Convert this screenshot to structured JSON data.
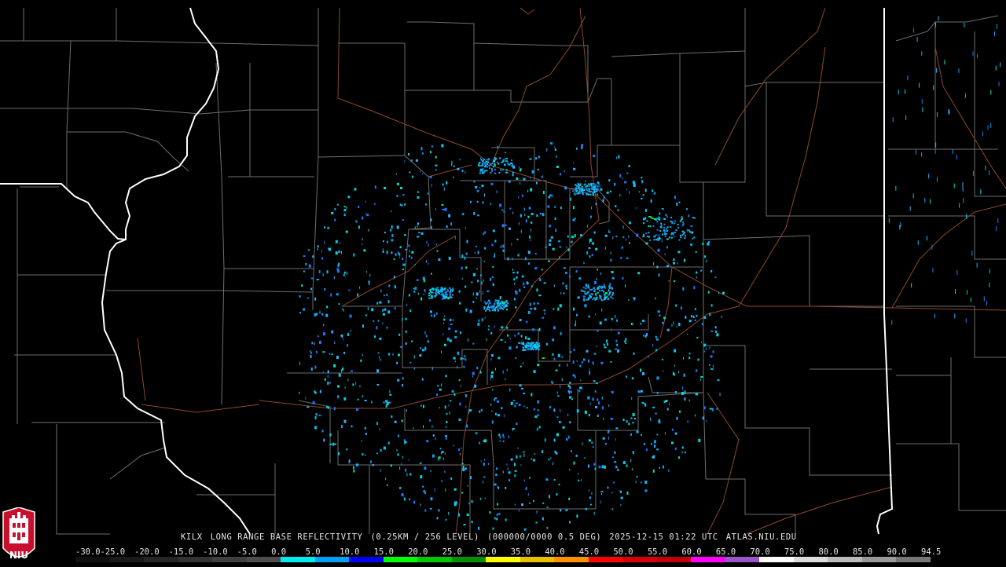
{
  "radar": {
    "station": "KILX",
    "product": "LONG RANGE BASE REFLECTIVITY",
    "resolution": "(0.25KM / 256 LEVEL)",
    "elevation": "(000000/0000 0.5 DEG)",
    "timestamp": "2025-12-15 01:22 UTC",
    "source": "ATLAS.NIU.EDU"
  },
  "scale": {
    "labels": [
      "-30.0",
      "-25.0",
      "-20.0",
      "-15.0",
      "-10.0",
      "-5.0",
      "0.0",
      "5.0",
      "10.0",
      "15.0",
      "20.0",
      "25.0",
      "30.0",
      "35.0",
      "40.0",
      "45.0",
      "50.0",
      "55.0",
      "60.0",
      "65.0",
      "70.0",
      "75.0",
      "80.0",
      "85.0",
      "90.0",
      "94.5"
    ],
    "colors": [
      "#101010",
      "#1a1a1a",
      "#262626",
      "#333333",
      "#404040",
      "#4d4d4d",
      "#00ecec",
      "#01a0f6",
      "#0000f6",
      "#00ff00",
      "#00c800",
      "#009000",
      "#ffff00",
      "#e7c000",
      "#ff9000",
      "#ff0000",
      "#d60000",
      "#c00000",
      "#ff00ff",
      "#9955c9",
      "#ffffff",
      "#dddddd",
      "#bbbbbb",
      "#999999",
      "#777777"
    ]
  },
  "logo": {
    "text": "NIU",
    "colors": {
      "red": "#c8102e",
      "white": "#ffffff"
    }
  },
  "map_colors": {
    "county": "#7a7a7a",
    "state": "#ffffff",
    "highway": "#8b4a2b"
  },
  "echo_palette": [
    "#00c8f0",
    "#0aa0f0",
    "#1e78ff",
    "#00e0d0",
    "#30b0ff"
  ]
}
